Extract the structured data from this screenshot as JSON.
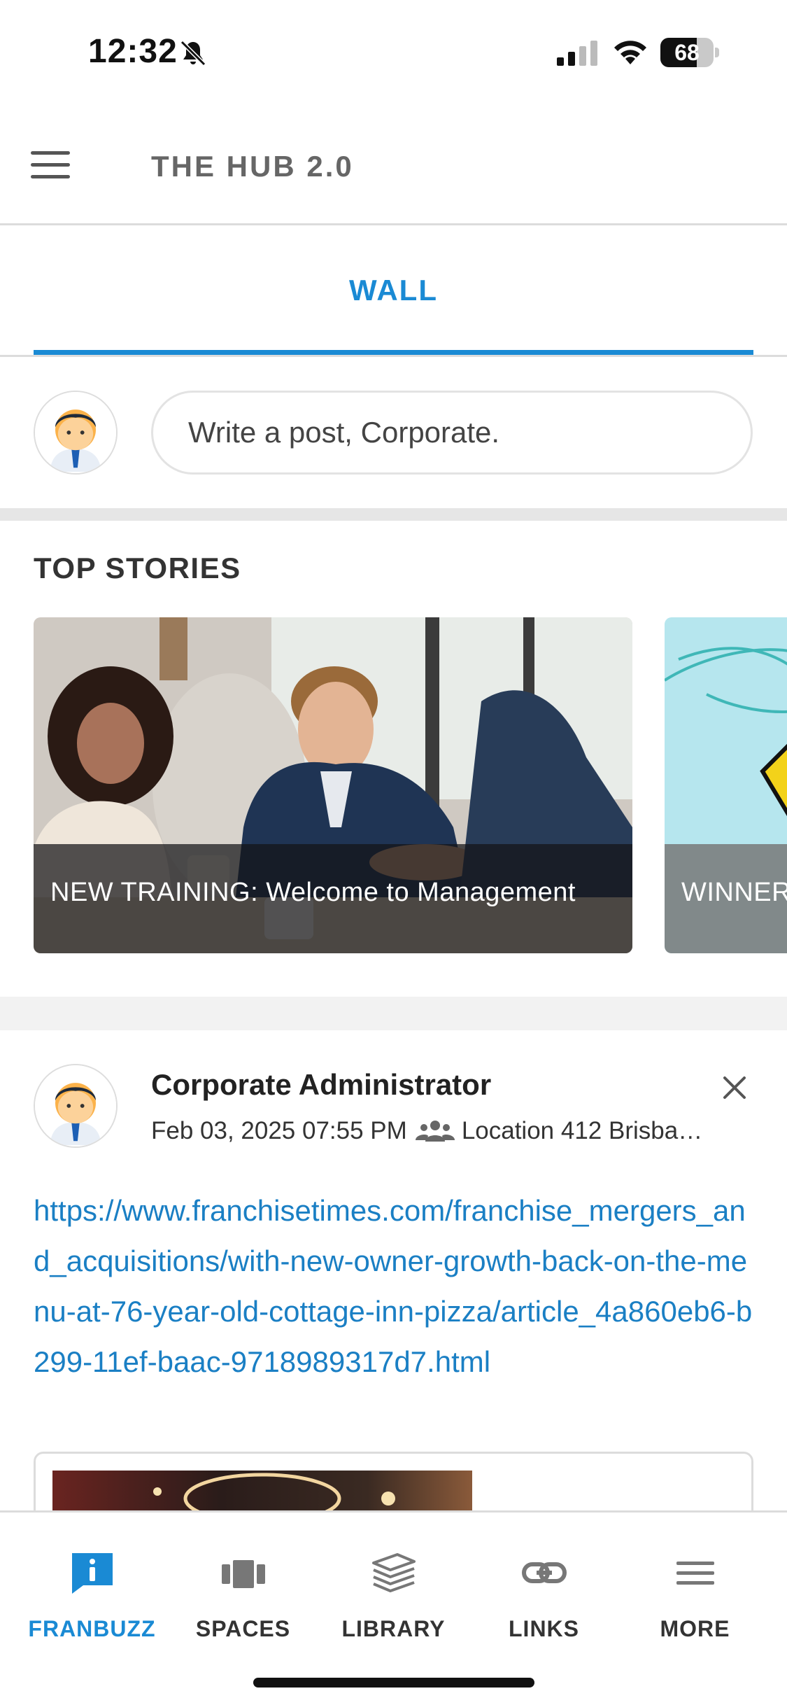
{
  "status_bar": {
    "time": "12:32",
    "battery": "68",
    "battery_level": 0.68
  },
  "header": {
    "title": "THE HUB 2.0",
    "menu_icon": "hamburger-menu-icon"
  },
  "tabs": [
    {
      "label": "WALL",
      "active": true
    }
  ],
  "composer": {
    "placeholder": "Write a post, Corporate."
  },
  "top_stories": {
    "title": "TOP STORIES",
    "stories": [
      {
        "caption": "NEW TRAINING: Welcome to Management"
      },
      {
        "caption": "WINNER"
      }
    ]
  },
  "post": {
    "author": "Corporate Administrator",
    "date": "Feb 03, 2025 07:55 PM",
    "location": "Location 412 Brisba…",
    "link": "https://www.franchisetimes.com/franchise_mergers_and_acquisitions/with-new-owner-growth-back-on-the-menu-at-76-year-old-cottage-inn-pizza/article_4a860eb6-b299-11ef-baac-9718989317d7.html"
  },
  "bottom_nav": [
    {
      "label": "FRANBUZZ",
      "icon": "info-chat-icon",
      "active": true
    },
    {
      "label": "SPACES",
      "icon": "spaces-icon",
      "active": false
    },
    {
      "label": "LIBRARY",
      "icon": "library-stack-icon",
      "active": false
    },
    {
      "label": "LINKS",
      "icon": "link-icon",
      "active": false
    },
    {
      "label": "MORE",
      "icon": "more-menu-icon",
      "active": false
    }
  ],
  "colors": {
    "accent": "#1a8ad4",
    "link": "#1a7fc4",
    "divider": "#dcdcdc"
  }
}
